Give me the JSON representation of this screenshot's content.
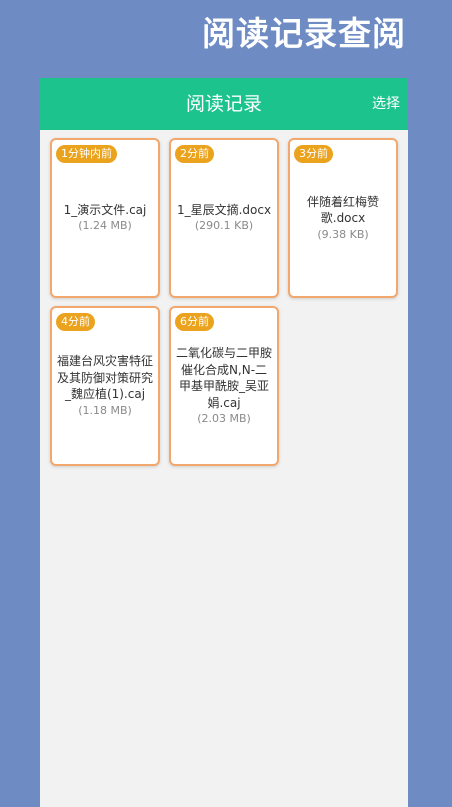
{
  "page": {
    "title": "阅读记录查阅"
  },
  "colors": {
    "background": "#6E8BC3",
    "header": "#1DC38D",
    "content_background": "#F2F2F2",
    "card_border": "#F2A76F",
    "badge": "#EBA31D"
  },
  "header": {
    "title": "阅读记录",
    "select_label": "选择"
  },
  "records": [
    {
      "time": "1分钟内前",
      "name": "1_演示文件.caj",
      "size": "(1.24 MB)"
    },
    {
      "time": "2分前",
      "name": "1_星辰文摘.docx",
      "size": "(290.1 KB)"
    },
    {
      "time": "3分前",
      "name": "伴随着红梅赞歌.docx",
      "size": "(9.38 KB)"
    },
    {
      "time": "4分前",
      "name": "福建台风灾害特征及其防御对策研究_魏应植(1).caj",
      "size": "(1.18 MB)"
    },
    {
      "time": "6分前",
      "name": "二氧化碳与二甲胺催化合成N,N-二甲基甲酰胺_吴亚娟.caj",
      "size": "(2.03 MB)"
    }
  ]
}
